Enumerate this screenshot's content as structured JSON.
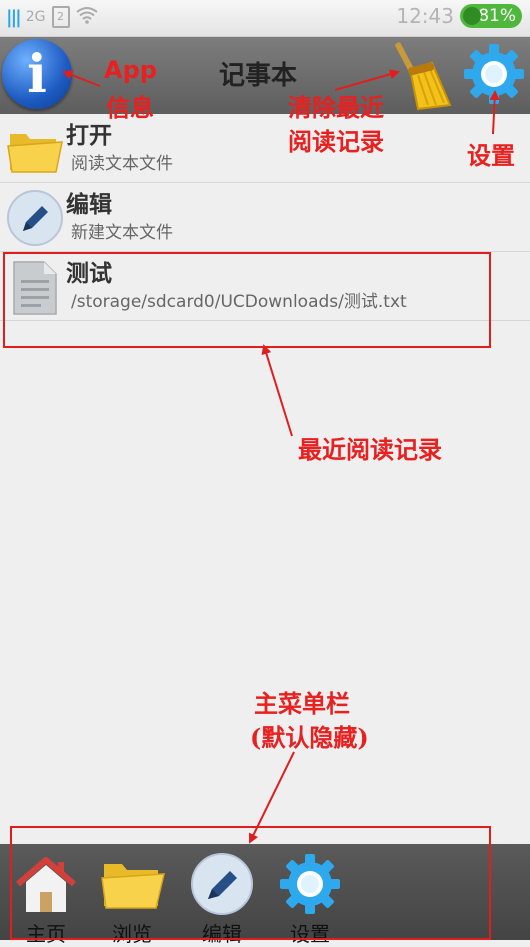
{
  "status_bar": {
    "network": "2G",
    "sim_slot": "2",
    "time": "12:43",
    "battery": "81%"
  },
  "header": {
    "title": "记事本"
  },
  "list": [
    {
      "title": "打开",
      "subtitle": "阅读文本文件",
      "icon": "folder-icon"
    },
    {
      "title": "编辑",
      "subtitle": "新建文本文件",
      "icon": "pencil-icon"
    },
    {
      "title": "测试",
      "subtitle": "/storage/sdcard0/UCDownloads/测试.txt",
      "icon": "text-file-icon"
    }
  ],
  "bottom_menu": [
    {
      "label": "主页",
      "icon": "home-icon"
    },
    {
      "label": "浏览",
      "icon": "folder-icon"
    },
    {
      "label": "编辑",
      "icon": "pencil-icon"
    },
    {
      "label": "设置",
      "icon": "gear-icon"
    }
  ],
  "annotations": {
    "app_info_1": "App",
    "app_info_2": "信息",
    "clear_1": "清除最近",
    "clear_2": "阅读记录",
    "settings": "设置",
    "recent": "最近阅读记录",
    "menu_1": "主菜单栏",
    "menu_2": "(默认隐藏)"
  },
  "colors": {
    "annotation": "#e82020",
    "header": "#6e6e6e",
    "battery": "#4fb83c"
  }
}
